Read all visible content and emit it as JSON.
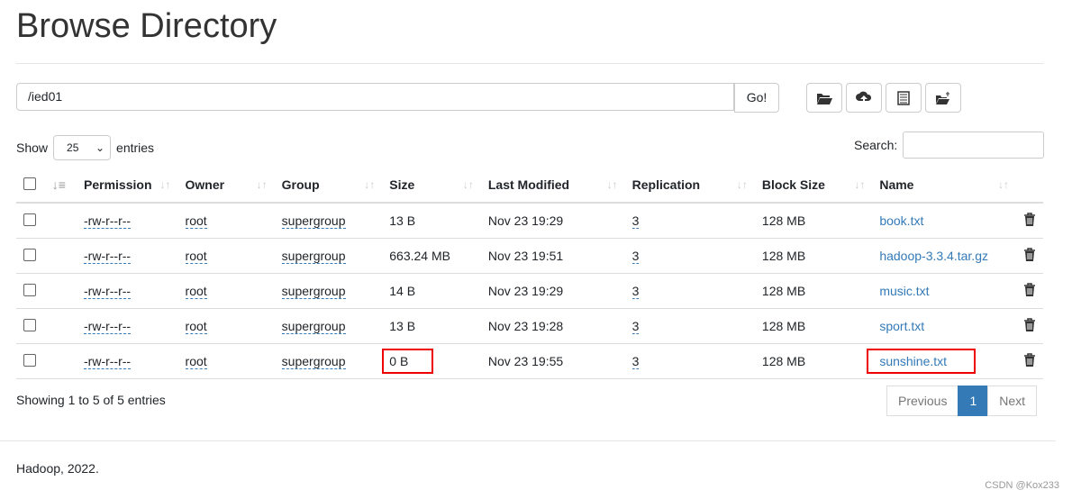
{
  "title": "Browse Directory",
  "path": "/ied01",
  "go_label": "Go!",
  "toolbar": [
    {
      "icon": "folder-open-icon"
    },
    {
      "icon": "cloud-upload-icon"
    },
    {
      "icon": "list-alt-icon"
    },
    {
      "icon": "folder-move-icon"
    }
  ],
  "show_label": "Show",
  "entries_value": "25",
  "entries_label": "entries",
  "search_label": "Search:",
  "columns": [
    "Permission",
    "Owner",
    "Group",
    "Size",
    "Last Modified",
    "Replication",
    "Block Size",
    "Name"
  ],
  "rows": [
    {
      "perm": "-rw-r--r--",
      "owner": "root",
      "group": "supergroup",
      "size": "13 B",
      "mod": "Nov 23 19:29",
      "rep": "3",
      "block": "128 MB",
      "name": "book.txt"
    },
    {
      "perm": "-rw-r--r--",
      "owner": "root",
      "group": "supergroup",
      "size": "663.24 MB",
      "mod": "Nov 23 19:51",
      "rep": "3",
      "block": "128 MB",
      "name": "hadoop-3.3.4.tar.gz"
    },
    {
      "perm": "-rw-r--r--",
      "owner": "root",
      "group": "supergroup",
      "size": "14 B",
      "mod": "Nov 23 19:29",
      "rep": "3",
      "block": "128 MB",
      "name": "music.txt"
    },
    {
      "perm": "-rw-r--r--",
      "owner": "root",
      "group": "supergroup",
      "size": "13 B",
      "mod": "Nov 23 19:28",
      "rep": "3",
      "block": "128 MB",
      "name": "sport.txt"
    },
    {
      "perm": "-rw-r--r--",
      "owner": "root",
      "group": "supergroup",
      "size": "0 B",
      "mod": "Nov 23 19:55",
      "rep": "3",
      "block": "128 MB",
      "name": "sunshine.txt"
    }
  ],
  "info": "Showing 1 to 5 of 5 entries",
  "pagination": {
    "prev": "Previous",
    "page": "1",
    "next": "Next"
  },
  "footer": "Hadoop, 2022.",
  "watermark": "CSDN @Kox233",
  "colors": {
    "link": "#337ab7",
    "highlight": "#ee0000"
  }
}
